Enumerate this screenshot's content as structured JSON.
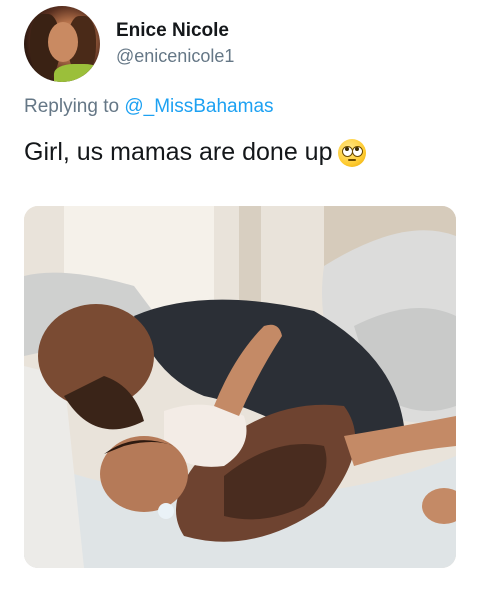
{
  "tweet": {
    "display_name": "Enice Nicole",
    "handle": "@enicenicole1",
    "reply_prefix": "Replying to ",
    "reply_mention": "@_MissBahamas",
    "text": "Girl, us mamas are done up",
    "emoji": "rolling-eyes-emoji"
  },
  "colors": {
    "accent": "#1da1f2",
    "secondary_text": "#657786",
    "primary_text": "#14171a"
  }
}
